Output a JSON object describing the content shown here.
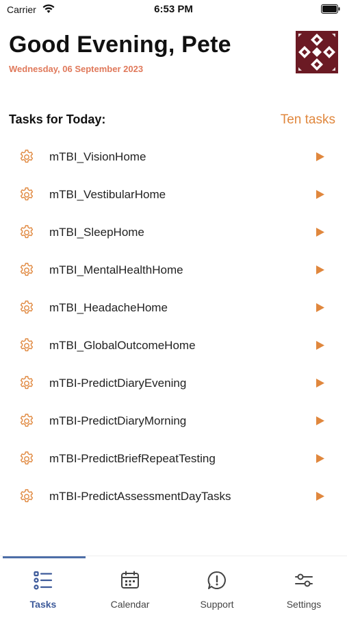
{
  "status": {
    "carrier": "Carrier",
    "time": "6:53 PM"
  },
  "header": {
    "greeting": "Good Evening, Pete",
    "date": "Wednesday, 06 September 2023"
  },
  "tasks": {
    "title": "Tasks for Today:",
    "count_label": "Ten tasks",
    "items": [
      {
        "label": "mTBI_VisionHome"
      },
      {
        "label": "mTBI_VestibularHome"
      },
      {
        "label": "mTBI_SleepHome"
      },
      {
        "label": "mTBI_MentalHealthHome"
      },
      {
        "label": "mTBI_HeadacheHome"
      },
      {
        "label": "mTBI_GlobalOutcomeHome"
      },
      {
        "label": "mTBI-PredictDiaryEvening"
      },
      {
        "label": "mTBI-PredictDiaryMorning"
      },
      {
        "label": "mTBI-PredictBriefRepeatTesting"
      },
      {
        "label": "mTBI-PredictAssessmentDayTasks"
      }
    ]
  },
  "tabbar": {
    "tabs": [
      {
        "label": "Tasks",
        "icon": "tasks-list-icon",
        "active": true
      },
      {
        "label": "Calendar",
        "icon": "calendar-icon",
        "active": false
      },
      {
        "label": "Support",
        "icon": "support-icon",
        "active": false
      },
      {
        "label": "Settings",
        "icon": "settings-sliders-icon",
        "active": false
      }
    ]
  },
  "colors": {
    "accent_orange": "#e0873d",
    "date_color": "#e0795b",
    "active_tab": "#3d5a9a",
    "avatar_maroon": "#6b1a24"
  }
}
